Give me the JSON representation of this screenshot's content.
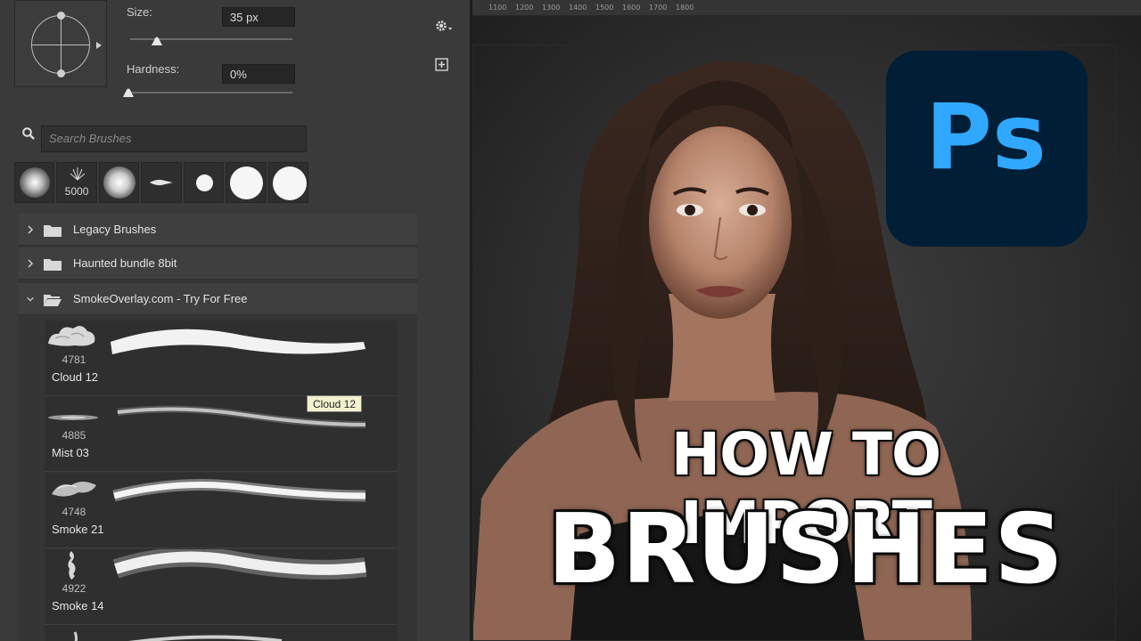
{
  "brush_panel": {
    "size_label": "Size:",
    "size_value": "35 px",
    "hardness_label": "Hardness:",
    "hardness_value": "0%",
    "search_placeholder": "Search Brushes",
    "recent_brushes": [
      {
        "icon": "soft-round-brush",
        "count": ""
      },
      {
        "icon": "grass-brush",
        "count": "5000"
      },
      {
        "icon": "soft-round-brush",
        "count": ""
      },
      {
        "icon": "pen-tip-brush",
        "count": ""
      },
      {
        "icon": "hard-round-small-brush",
        "count": ""
      },
      {
        "icon": "hard-round-brush",
        "count": ""
      },
      {
        "icon": "hard-round-brush",
        "count": ""
      }
    ],
    "groups": [
      {
        "name": "Legacy Brushes",
        "expanded": false
      },
      {
        "name": "Haunted bundle 8bit",
        "expanded": false
      },
      {
        "name": "SmokeOverlay.com - Try For Free",
        "expanded": true
      }
    ],
    "brushes": [
      {
        "count": "4781",
        "name": "Cloud 12"
      },
      {
        "count": "4885",
        "name": "Mist 03"
      },
      {
        "count": "4748",
        "name": "Smoke 21"
      },
      {
        "count": "4922",
        "name": "Smoke 14"
      }
    ],
    "tooltip": "Cloud 12"
  },
  "ruler_labels": [
    "1100",
    "1200",
    "1300",
    "1400",
    "1500",
    "1600",
    "1700",
    "1800"
  ],
  "logo": {
    "text": "Ps",
    "bg": "#001e36",
    "fg": "#31a8ff"
  },
  "headline": {
    "line1": "HOW TO IMPORT",
    "line2": "BRUSHES"
  }
}
